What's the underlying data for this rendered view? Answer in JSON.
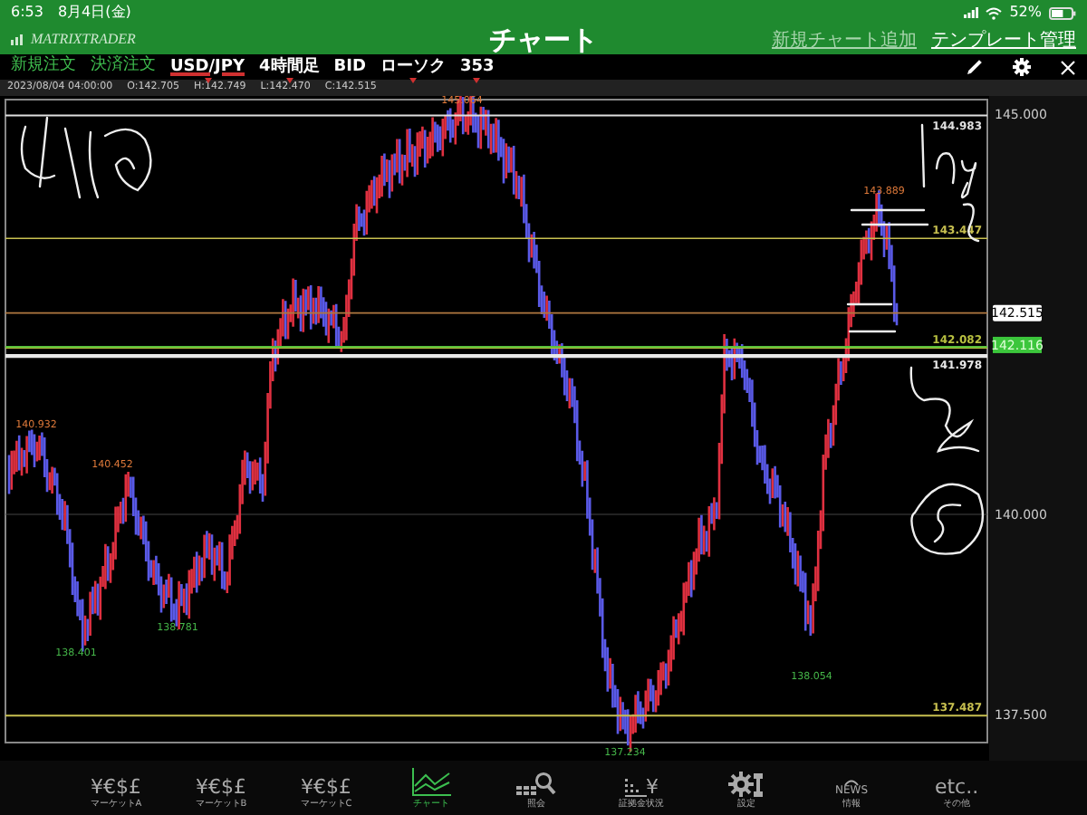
{
  "status_bar": {
    "time": "6:53",
    "date": "8月4日(金)",
    "battery": "52%"
  },
  "header": {
    "logo": "MATRIXTRADER",
    "title": "チャート",
    "actions": [
      {
        "label": "新規チャート追加",
        "kind": "muted"
      },
      {
        "label": "テンプレート管理",
        "kind": "plain"
      }
    ]
  },
  "toolbar": {
    "order_links": [
      "新規注文",
      "決済注文"
    ],
    "selectors": [
      {
        "label": "USD/JPY",
        "kind": "pair",
        "dropdown": true
      },
      {
        "label": "4時間足",
        "kind": "option",
        "dropdown": true
      },
      {
        "label": "BID",
        "kind": "option",
        "dropdown": false
      },
      {
        "label": "ローソク",
        "kind": "option",
        "dropdown": true
      },
      {
        "label": "353",
        "kind": "option",
        "dropdown": true
      }
    ]
  },
  "ohlc": {
    "datetime": "2023/08/04 04:00:00",
    "open": "O:142.705",
    "high": "H:142.749",
    "low": "L:142.470",
    "close": "C:142.515"
  },
  "chart": {
    "axis_labels": [
      {
        "text": "145.000",
        "kind": "tick"
      },
      {
        "text": "142.515",
        "kind": "current"
      },
      {
        "text": "142.116",
        "kind": "bid"
      },
      {
        "text": "140.000",
        "kind": "tick"
      },
      {
        "text": "137.500",
        "kind": "tick"
      }
    ],
    "lines": [
      {
        "label": "144.983",
        "color": "#e0e0e0"
      },
      {
        "label": "143.447",
        "color": "#c8c050"
      },
      {
        "label": "142.082",
        "color": "#b8c040"
      },
      {
        "label": "141.978",
        "color": "#e8e8e8"
      },
      {
        "label": "137.487",
        "color": "#c8c050"
      }
    ],
    "extremes": [
      {
        "text": "145.064",
        "kind": "high"
      },
      {
        "text": "143.889",
        "kind": "high"
      },
      {
        "text": "140.932",
        "kind": "high"
      },
      {
        "text": "140.452",
        "kind": "high"
      },
      {
        "text": "138.401",
        "kind": "low"
      },
      {
        "text": "138.781",
        "kind": "low"
      },
      {
        "text": "137.234",
        "kind": "low"
      },
      {
        "text": "138.054",
        "kind": "low"
      }
    ]
  },
  "nav": [
    {
      "label": "マーケットA",
      "kind": "currency",
      "icon_text": "¥€$£",
      "selected": false
    },
    {
      "label": "マーケットB",
      "kind": "currency",
      "icon_text": "¥€$£",
      "selected": false
    },
    {
      "label": "マーケットC",
      "kind": "currency",
      "icon_text": "¥€$£",
      "selected": false
    },
    {
      "label": "チャート",
      "kind": "chart",
      "selected": true
    },
    {
      "label": "照会",
      "kind": "search",
      "selected": false
    },
    {
      "label": "証拠金状況",
      "kind": "margin",
      "icon_text": "¥",
      "selected": false
    },
    {
      "label": "設定",
      "kind": "settings",
      "selected": false
    },
    {
      "label": "情報",
      "kind": "news",
      "icon_text": "NEWS",
      "selected": false
    },
    {
      "label": "その他",
      "kind": "other",
      "icon_text": "etc..",
      "selected": false
    }
  ]
}
